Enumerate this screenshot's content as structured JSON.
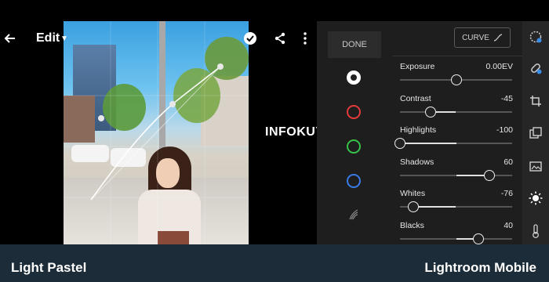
{
  "header": {
    "edit_label": "Edit"
  },
  "watermark": "INFOKUY.NET",
  "channels": {
    "done_label": "DONE",
    "items": [
      {
        "name": "rgb",
        "color": "#ffffff"
      },
      {
        "name": "red",
        "color": "#e33a3a"
      },
      {
        "name": "green",
        "color": "#38c048"
      },
      {
        "name": "blue",
        "color": "#3a7ae6"
      }
    ]
  },
  "panel": {
    "curve_label": "CURVE",
    "sliders": [
      {
        "label": "Exposure",
        "value": "0.00EV",
        "level": 0.5
      },
      {
        "label": "Contrast",
        "value": "-45",
        "level": 0.27
      },
      {
        "label": "Highlights",
        "value": "-100",
        "level": 0.0
      },
      {
        "label": "Shadows",
        "value": "60",
        "level": 0.8
      },
      {
        "label": "Whites",
        "value": "-76",
        "level": 0.12
      },
      {
        "label": "Blacks",
        "value": "40",
        "level": 0.7
      }
    ]
  },
  "toolbar": {
    "items": [
      "presets-icon",
      "heal-icon",
      "crop-icon",
      "profiles-icon",
      "auto-icon",
      "light-icon",
      "color-icon"
    ],
    "active": "light-icon"
  },
  "footer": {
    "left_text": "Light Pastel",
    "right_text": "Lightroom Mobile"
  }
}
